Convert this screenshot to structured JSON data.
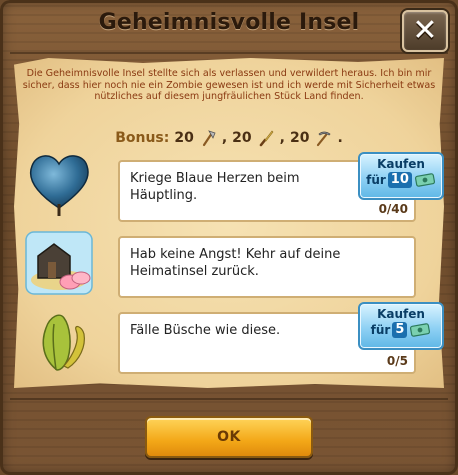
{
  "dialog": {
    "title": "Geheimnisvolle Insel",
    "close_icon": "close-x-icon",
    "intro": "Die Geheimnisvolle Insel stellte sich als verlassen und verwildert heraus. Ich bin mir sicher, dass hier noch nie ein Zombie gewesen ist und ich werde mit Sicherheit etwas nützliches auf diesem jungfräulichen Stück Land finden."
  },
  "bonus": {
    "label": "Bonus:",
    "items": [
      {
        "amount": "20",
        "icon": "axe-icon"
      },
      {
        "amount": "20",
        "icon": "knife-icon"
      },
      {
        "amount": "20",
        "icon": "pickaxe-icon"
      }
    ],
    "separator": ",",
    "end": "."
  },
  "tasks": [
    {
      "text": "Kriege Blaue Herzen beim Häuptling.",
      "icon": "blue-heart-icon",
      "progress": "0/40",
      "buy": {
        "label": "Kaufen",
        "prefix": "für",
        "price": "10",
        "icon": "cash-icon"
      }
    },
    {
      "text": "Hab keine Angst! Kehr auf deine Heimatinsel zurück.",
      "icon": "home-island-icon",
      "progress": "",
      "buy": null
    },
    {
      "text": "Fälle Büsche wie diese.",
      "icon": "bush-icon",
      "progress": "0/5",
      "buy": {
        "label": "Kaufen",
        "prefix": "für",
        "price": "5",
        "icon": "cash-icon"
      }
    }
  ],
  "ok_button": {
    "label": "OK"
  },
  "colors": {
    "intro_text": "#8a3a12",
    "buy_button": "#8fd1f4",
    "ok_button": "#f3a818"
  }
}
